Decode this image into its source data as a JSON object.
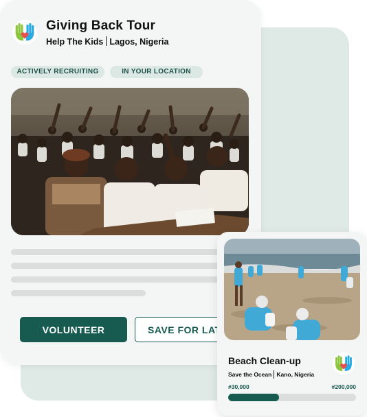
{
  "main_card": {
    "title": "Giving Back Tour",
    "organization": "Help The Kids",
    "location": "Lagos, Nigeria",
    "tags": [
      "ACTIVELY RECRUITING",
      "IN YOUR LOCATION"
    ],
    "primary_button": "VOLUNTEER",
    "secondary_button": "SAVE FOR LATER"
  },
  "beach_card": {
    "title": "Beach Clean-up",
    "organization": "Save the Ocean",
    "location": "Kano, Nigeria",
    "raised": "#30,000",
    "goal": "#200,000",
    "progress_fraction": 0.4
  },
  "colors": {
    "brand": "#165a50",
    "tag_bg": "#dbe8e4",
    "panel_bg": "#dfe9e6"
  },
  "icons": {
    "logo": "hands-heart-icon"
  }
}
